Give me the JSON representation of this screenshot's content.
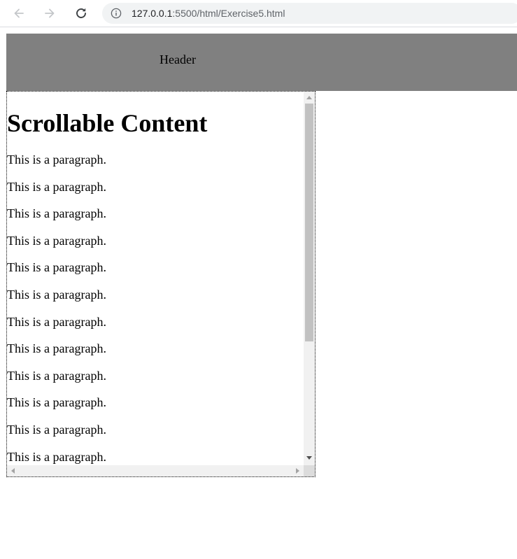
{
  "browser": {
    "url_host": "127.0.0.1",
    "url_path": ":5500/html/Exercise5.html",
    "icons": {
      "back": "back-arrow-icon",
      "forward": "forward-arrow-icon",
      "reload": "reload-icon",
      "info": "info-icon"
    }
  },
  "page": {
    "header_text": "Header",
    "heading": "Scrollable Content",
    "paragraphs": [
      "This is a paragraph.",
      "This is a paragraph.",
      "This is a paragraph.",
      "This is a paragraph.",
      "This is a paragraph.",
      "This is a paragraph.",
      "This is a paragraph.",
      "This is a paragraph.",
      "This is a paragraph.",
      "This is a paragraph.",
      "This is a paragraph.",
      "This is a paragraph."
    ],
    "colors": {
      "header_background": "#808080",
      "scrollbar_track": "#f1f1f1",
      "scrollbar_thumb": "#c1c1c1"
    }
  }
}
